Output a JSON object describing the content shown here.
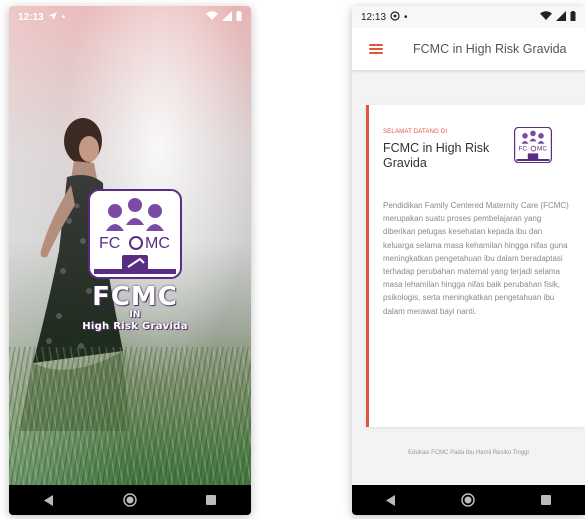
{
  "splash": {
    "status_time": "12:13",
    "brand_big": "FCMC",
    "brand_in": "IN",
    "brand_sub": "High Risk Gravida",
    "logo_text_left": "FC",
    "logo_text_right": "MC"
  },
  "app": {
    "status_time": "12:13",
    "title": "FCMC in High Risk Gravida",
    "welcome_label": "SELAMAT DATANG DI",
    "card_title": "FCMC in High Risk Gravida",
    "description": "Pendidikan Family Centered Maternity Care (FCMC) merupakan suatu proses pembelajaran yang diberikan petugas kesehatan kepada ibu dan keluarga selama masa kehamilan hingga nifas guna meningkatkan pengetahuan ibu dalam beradaptasi terhadap perubahan maternal yang terjadi selama masa lehamilan hingga nifas baik perubahan fisik, psikologis, serta meningkatkan pengetahuan ibu dalam merawat bayi nanti.",
    "footer": "Edukasi FCMC Pada Ibu Hamil Resiko Tinggi",
    "logo_text_left": "FC",
    "logo_text_right": "MC"
  },
  "icons": {
    "nav": [
      "back-icon",
      "home-icon",
      "recents-icon"
    ],
    "status": [
      "navigation-icon",
      "whatsapp-icon",
      "wifi-icon",
      "signal-icon",
      "battery-icon"
    ]
  },
  "colors": {
    "accent": "#e0553e",
    "logo_purple": "#5a2d84"
  }
}
